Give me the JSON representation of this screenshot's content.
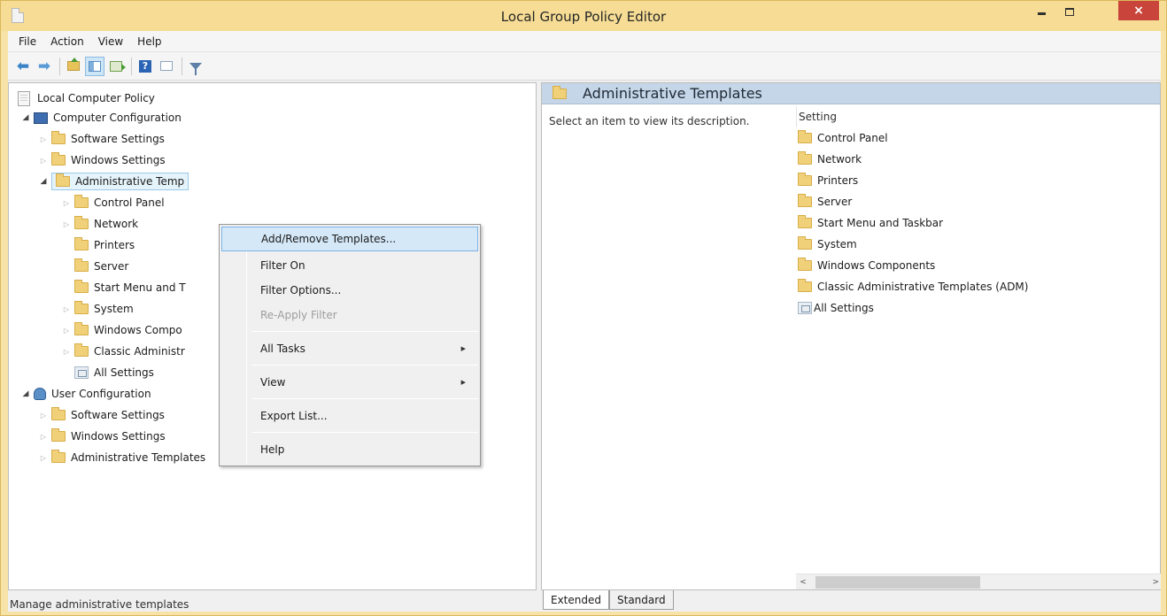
{
  "window": {
    "title": "Local Group Policy Editor",
    "close_glyph": "×"
  },
  "menubar": {
    "items": [
      "File",
      "Action",
      "View",
      "Help"
    ]
  },
  "toolbar": {
    "icons": [
      "back-arrow-icon",
      "forward-arrow-icon",
      "up-one-level-icon",
      "show-hide-console-tree-icon",
      "export-list-icon",
      "help-icon",
      "properties-icon",
      "filter-icon"
    ],
    "back_glyph": "⬅",
    "forward_glyph": "➡",
    "help_glyph": "?"
  },
  "tree": {
    "root": "Local Computer Policy",
    "computer_config": {
      "label": "Computer Configuration",
      "children": [
        "Software Settings",
        "Windows Settings",
        "Administrative Temp"
      ],
      "admin_children": [
        "Control Panel",
        "Network",
        "Printers",
        "Server",
        "Start Menu and T",
        "System",
        "Windows Compo",
        "Classic Administr",
        "All Settings"
      ]
    },
    "user_config": {
      "label": "User Configuration",
      "children": [
        "Software Settings",
        "Windows Settings",
        "Administrative Templates"
      ]
    },
    "expand_glyph_closed": "▷",
    "expand_glyph_open": "◢"
  },
  "context_menu": {
    "items": [
      {
        "label": "Add/Remove Templates...",
        "state": "hover"
      },
      {
        "label": "Filter On",
        "state": "normal"
      },
      {
        "label": "Filter Options...",
        "state": "normal"
      },
      {
        "label": "Re-Apply Filter",
        "state": "disabled"
      },
      {
        "label": "All Tasks",
        "state": "submenu"
      },
      {
        "label": "View",
        "state": "submenu"
      },
      {
        "label": "Export List...",
        "state": "normal"
      },
      {
        "label": "Help",
        "state": "normal"
      }
    ],
    "submenu_glyph": "▶"
  },
  "right_pane": {
    "title": "Administrative Templates",
    "description": "Select an item to view its description.",
    "column_header": "Setting",
    "items": [
      "Control Panel",
      "Network",
      "Printers",
      "Server",
      "Start Menu and Taskbar",
      "System",
      "Windows Components",
      "Classic Administrative Templates (ADM)",
      "All Settings"
    ],
    "scroll_left": "<",
    "scroll_right": ">"
  },
  "tabs": [
    "Extended",
    "Standard"
  ],
  "status_bar": {
    "text": "Manage administrative templates"
  },
  "colors": {
    "title_bar": "#f6dc94",
    "close_button": "#c9453b",
    "right_header": "#c5d6e8",
    "menu_hover": "#d5e8f8"
  }
}
